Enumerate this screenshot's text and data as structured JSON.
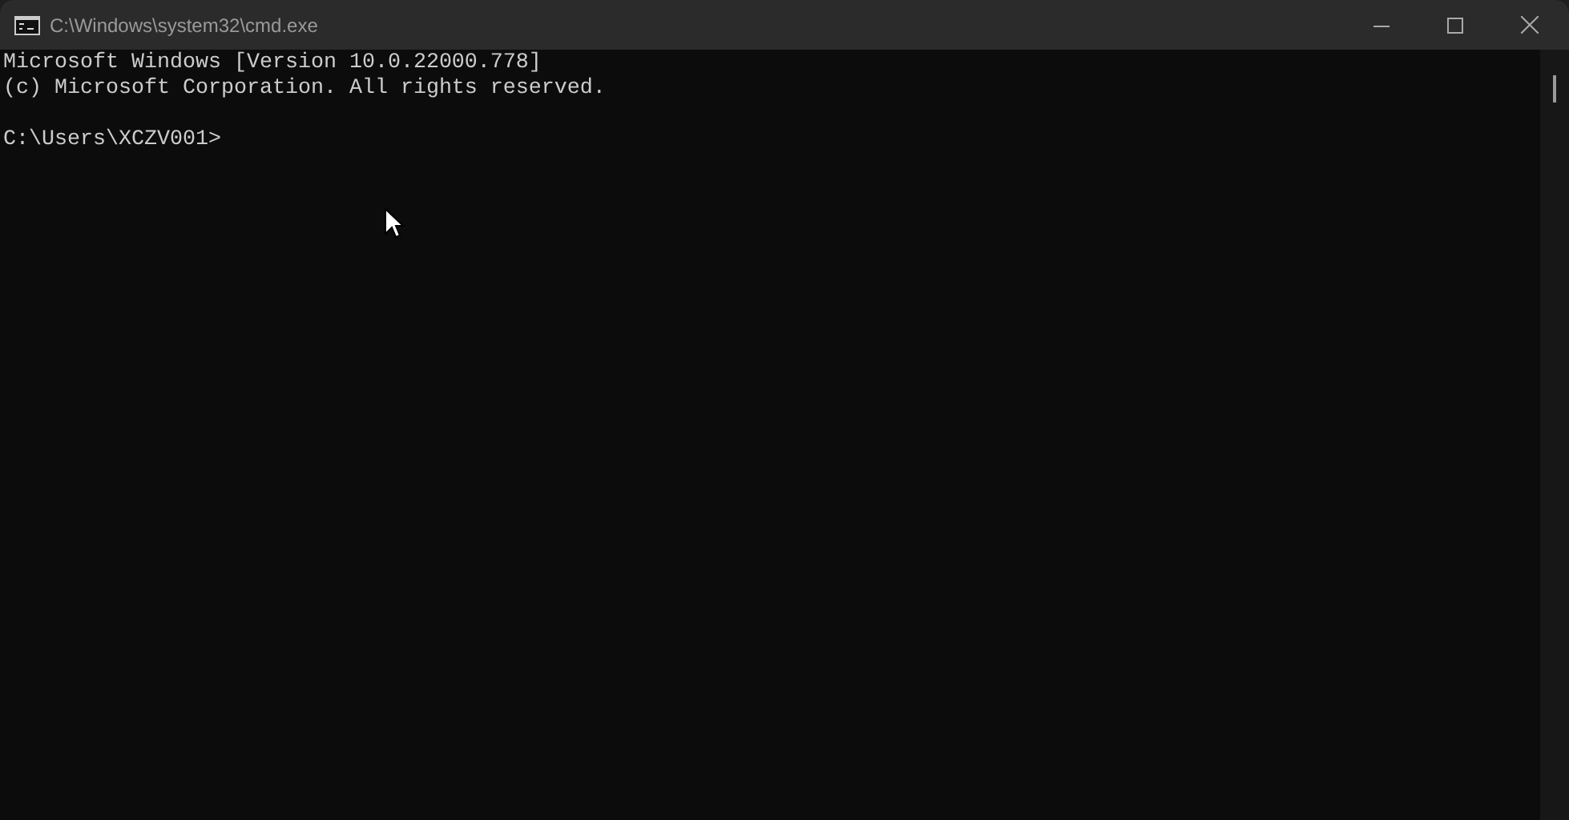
{
  "window": {
    "title": "C:\\Windows\\system32\\cmd.exe"
  },
  "console": {
    "lines": [
      "Microsoft Windows [Version 10.0.22000.778]",
      "(c) Microsoft Corporation. All rights reserved."
    ],
    "prompt": "C:\\Users\\XCZV001>"
  }
}
